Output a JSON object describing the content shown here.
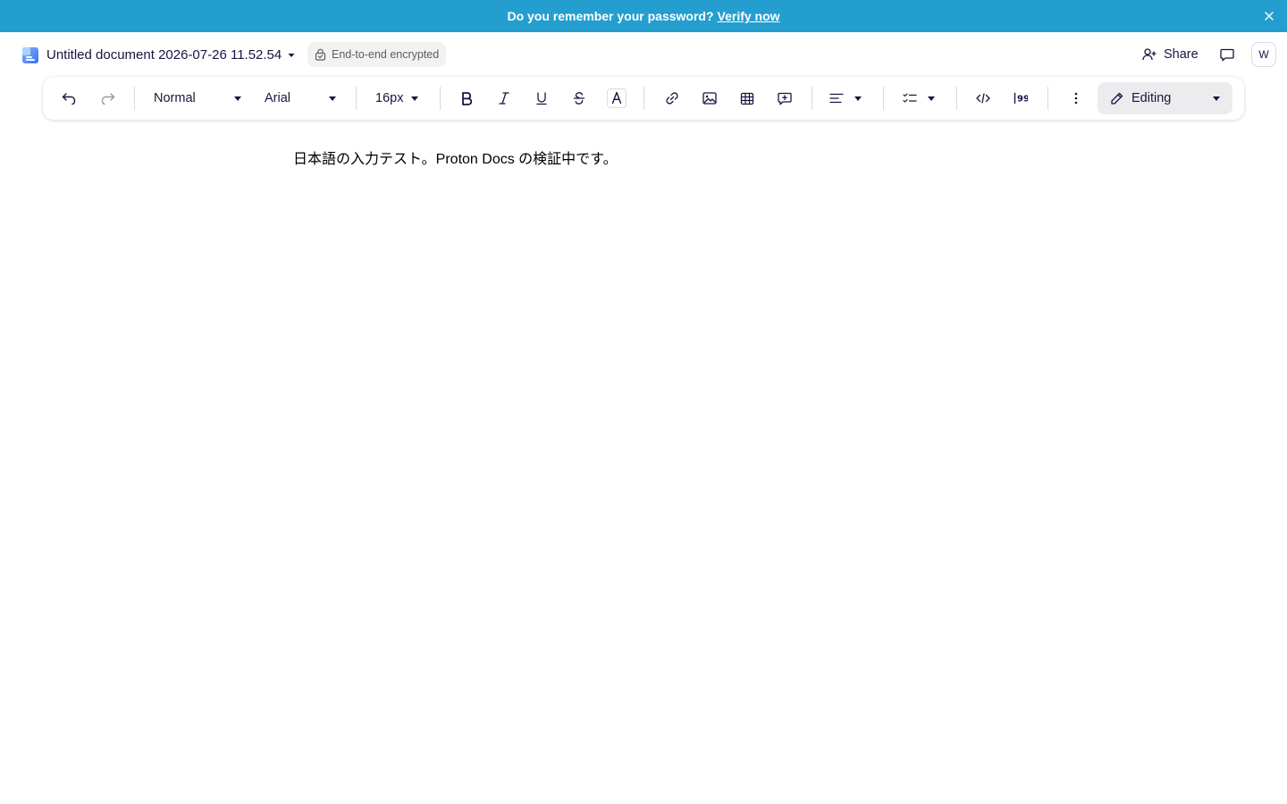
{
  "banner": {
    "message": "Do you remember your password?",
    "link": "Verify now",
    "background": "#239ece"
  },
  "header": {
    "doc_icon": "docs-icon",
    "title": "Untitled document 2026-07-26 11.52.54",
    "encryption_badge": "End-to-end encrypted",
    "share_label": "Share",
    "avatar_initial": "W"
  },
  "toolbar": {
    "block_style": "Normal",
    "font_family": "Arial",
    "font_size": "16px",
    "mode_label": "Editing",
    "icons": [
      "undo-icon",
      "redo-icon",
      "bold-icon",
      "italic-icon",
      "underline-icon",
      "strikethrough-icon",
      "text-color-icon",
      "link-icon",
      "image-icon",
      "table-icon",
      "comment-icon",
      "align-icon",
      "list-icon",
      "code-icon",
      "quote-icon",
      "more-icon",
      "pencil-icon"
    ]
  },
  "document": {
    "content": "日本語の入力テスト。Proton Docs の検証中です。"
  }
}
